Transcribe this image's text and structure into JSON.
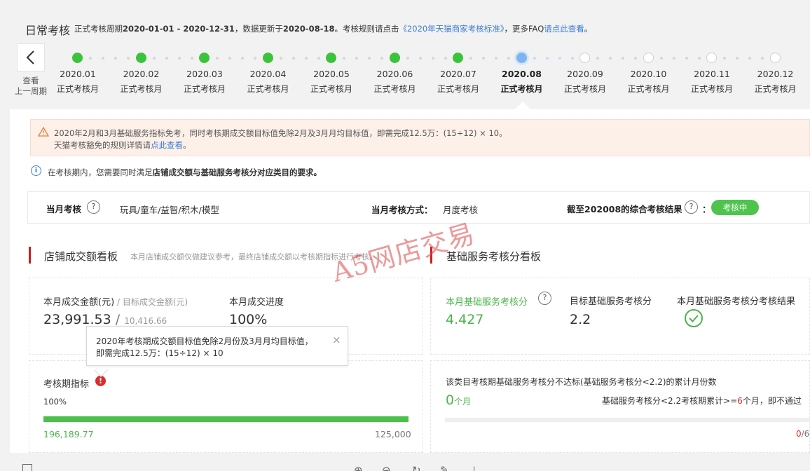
{
  "header": {
    "title": "日常考核",
    "desc_prefix": "正式考核周期",
    "period": "2020-01-01 - 2020-12-31",
    "desc_mid": "，数据更新于",
    "update_date": "2020-08-18",
    "desc_rule": "。考核规则请点击",
    "rule_link": "《2020年天猫商家考核标准》",
    "desc_faq": "，更多FAQ",
    "faq_link": "请点此查看",
    "desc_end": "。"
  },
  "timeline": {
    "back_label_1": "查看",
    "back_label_2": "上一周期",
    "months": [
      {
        "label": "2020.01",
        "status": "正式考核月",
        "state": "done"
      },
      {
        "label": "2020.02",
        "status": "正式考核月",
        "state": "done"
      },
      {
        "label": "2020.03",
        "status": "正式考核月",
        "state": "done"
      },
      {
        "label": "2020.04",
        "status": "正式考核月",
        "state": "done"
      },
      {
        "label": "2020.05",
        "status": "正式考核月",
        "state": "done"
      },
      {
        "label": "2020.06",
        "status": "正式考核月",
        "state": "done"
      },
      {
        "label": "2020.07",
        "status": "正式考核月",
        "state": "done"
      },
      {
        "label": "2020.08",
        "status": "正式考核月",
        "state": "current"
      },
      {
        "label": "2020.09",
        "status": "正式考核月",
        "state": "todo"
      },
      {
        "label": "2020.10",
        "status": "正式考核月",
        "state": "todo"
      },
      {
        "label": "2020.11",
        "status": "正式考核月",
        "state": "todo"
      },
      {
        "label": "2020.12",
        "status": "正式考核月",
        "state": "todo"
      }
    ]
  },
  "alert": {
    "line1": "2020年2月和3月基础服务指标免考，同时考核期成交额目标值免除2月及3月月均目标值，即需完成12.5万：(15÷12) × 10。",
    "line2_prefix": "天猫考核豁免的规则详情请",
    "line2_link": "点此查看",
    "line2_end": "。"
  },
  "info": {
    "prefix": "在考核期内，您需要同时满足",
    "bold": "店铺成交额与基础服务考核分对应类目的要求。"
  },
  "kbar": {
    "month_label": "当月考核",
    "category": "玩具/童车/益智/积木/模型",
    "method_label": "当月考核方式：",
    "method_value": "月度考核",
    "result_label": "截至202008的综合考核结果",
    "result_colon": "：",
    "result_badge": "考核中"
  },
  "sales": {
    "section_title": "店铺成交额看板",
    "section_note": "本月店铺成交额仅做建议参考，最终店铺成交额以考核期指标进行考核。",
    "amount_label": "本月成交金额(元)",
    "target_label": " / 目标成交金额(元)",
    "amount": "23,991.53",
    "slash": " / ",
    "target": "10,416.66",
    "progress_label": "本月成交进度",
    "progress_value": "100%",
    "period_label": "考核期指标",
    "period_pct": "100%",
    "period_progress": 1.0,
    "period_actual": "196,189.77",
    "period_target": "125,000"
  },
  "tooltip": {
    "line1": "2020年考核期成交额目标值免除2月份及3月月均目标值，",
    "line2": "即需完成12.5万：(15÷12) × 10",
    "close": "×"
  },
  "service": {
    "section_title": "基础服务考核分看板",
    "score_label": "本月基础服务考核分",
    "score": "4.427",
    "target_label": "目标基础服务考核分",
    "target": "2.2",
    "result_label": "本月基础服务考核分考核结果",
    "fail_label": "该类目考核期基础服务考核分不达标(基础服务考核分<2.2)的累计月份数",
    "fail_count": "0",
    "fail_unit": "个月",
    "fail_rule_prefix": "基础服务考核分<2.2考核期累计>=",
    "fail_rule_num": "6",
    "fail_rule_end": "个月，即不通过",
    "fail_progress": 0,
    "fail_ratio_num": "0",
    "fail_ratio_den": "/6"
  },
  "watermark": "A5网店交易",
  "colors": {
    "done": "#3cc33c",
    "current": "#7fb5ee",
    "accent_red": "#c9201c",
    "link": "#3a7bd5",
    "green": "#4bb54b"
  }
}
